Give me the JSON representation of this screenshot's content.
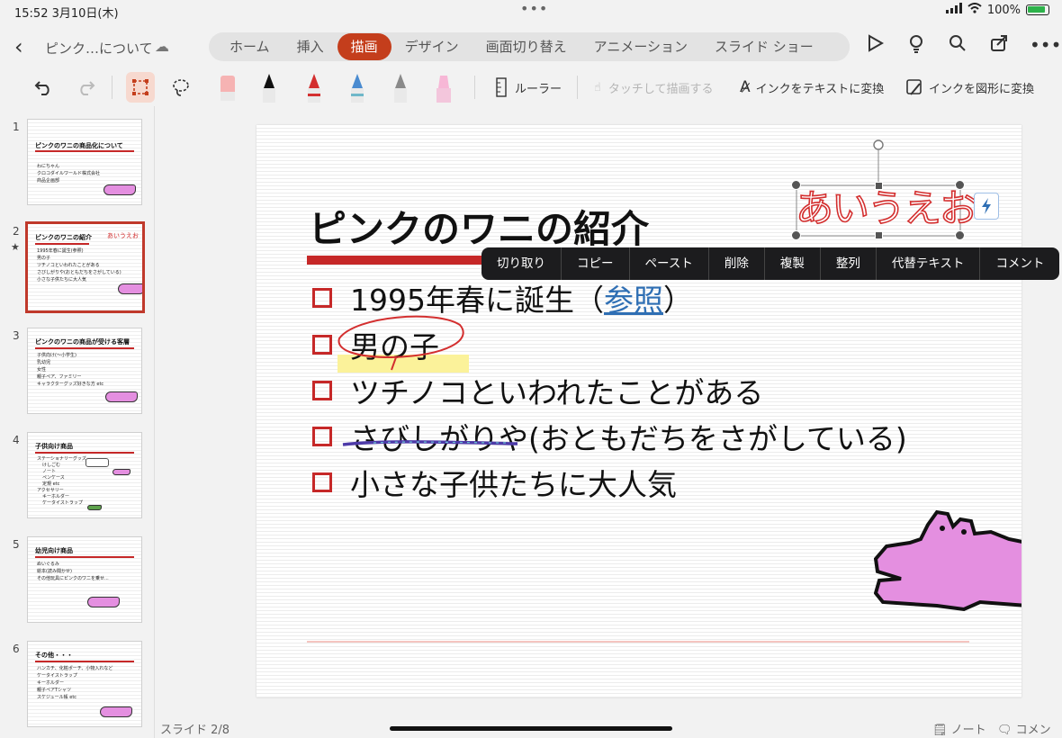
{
  "status": {
    "time": "15:52",
    "date": "3月10日(木)",
    "battery": "100%"
  },
  "header": {
    "doc_title": "ピンク…について",
    "tabs": [
      "ホーム",
      "挿入",
      "描画",
      "デザイン",
      "画面切り替え",
      "アニメーション",
      "スライド ショー"
    ],
    "active_tab": "描画"
  },
  "toolbar": {
    "ruler": "ルーラー",
    "touch_draw": "タッチして描画する",
    "ink_to_text": "インクをテキストに変換",
    "ink_to_shape": "インクを図形に変換"
  },
  "colors": {
    "accent": "#c43e1c",
    "bullet_red": "#c62828",
    "link": "#2f6fb4",
    "croc": "#e48fe0"
  },
  "thumbnails": [
    {
      "num": "1",
      "title": "ピンクのワニの商品化について",
      "lines": [
        "わにちゃん",
        "クロコダイルワールド株式会社",
        "商品企画部"
      ]
    },
    {
      "num": "2",
      "title": "ピンクのワニの紹介",
      "ink": "あいうえお",
      "lines": [
        "1995年春に誕生(参照)",
        "男の子",
        "ツチノコといわれたことがある",
        "さびしがりや(おともだちをさがしている)",
        "小さな子供たちに大人気"
      ]
    },
    {
      "num": "3",
      "title": "ピンクのワニの商品が受ける客層",
      "lines": [
        "子供向け(～小学生)",
        "乳幼児",
        "女性",
        "親子ペア、ファミリー",
        "キャラクターグッズ好きな方 etc"
      ]
    },
    {
      "num": "4",
      "title": "子供向け商品",
      "lines": [
        "ステーショナリーグッズ",
        "けしごむ",
        "ノート",
        "ペンケース",
        "定規 etc",
        "アクセサリー",
        "キーホルダー",
        "ケータイストラップ"
      ]
    },
    {
      "num": "5",
      "title": "幼児向け商品",
      "lines": [
        "ぬいぐるみ",
        "絵本(読み聞かせ)",
        "その他玩具にピンクのワニを乗せ..."
      ]
    },
    {
      "num": "6",
      "title": "その他・・・",
      "lines": [
        "ハンカチ、化粧ポーチ、小物入れなど",
        "ケータイストラップ",
        "キーホルダー",
        "親子ペアTシャツ",
        "スケジュール帳 etc"
      ]
    }
  ],
  "slide": {
    "title": "ピンクのワニの紹介",
    "ink_text": "あいうえお",
    "bullets": [
      {
        "pre": "1995年春に誕生（",
        "link": "参照",
        "post": "）"
      },
      {
        "pre": "男の子"
      },
      {
        "pre": "ツチノコといわれたことがある"
      },
      {
        "pre": "さびしがりや(おともだちをさがしている)"
      },
      {
        "pre": "小さな子供たちに大人気"
      }
    ]
  },
  "context_menu": [
    "切り取り",
    "コピー",
    "ペースト",
    "削除",
    "複製",
    "整列",
    "代替テキスト",
    "コメント"
  ],
  "footer": {
    "slide_number": "スライド 2/8",
    "notes": "ノート",
    "comments": "コメント"
  }
}
